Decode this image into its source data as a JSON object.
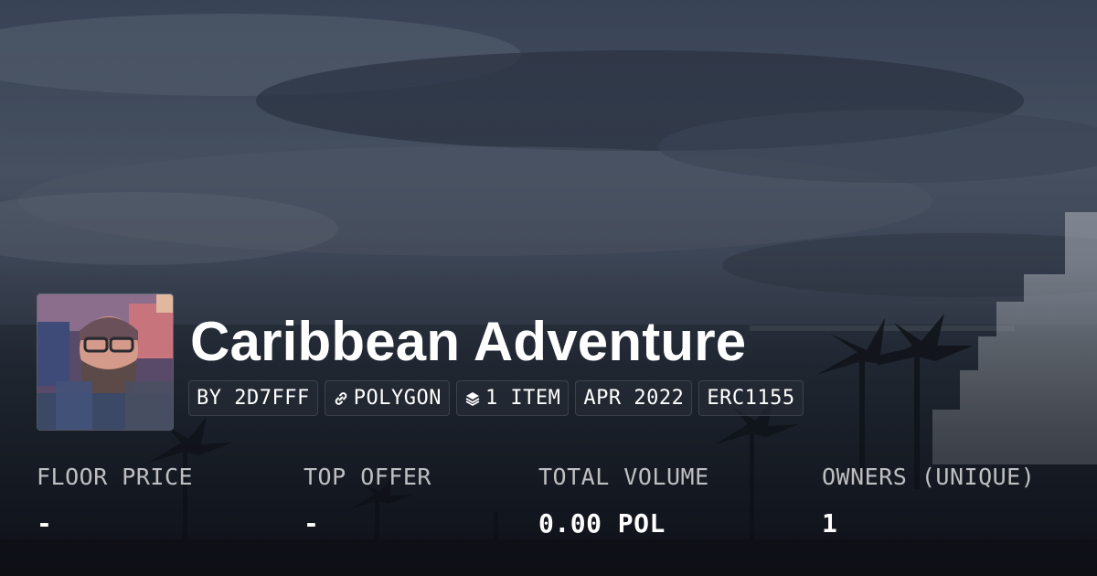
{
  "collection": {
    "title": "Caribbean Adventure",
    "tags": [
      {
        "label": "BY 2D7FFF",
        "icon": ""
      },
      {
        "label": "POLYGON",
        "icon": "chain-link-icon"
      },
      {
        "label": "1 ITEM",
        "icon": "layers-icon"
      },
      {
        "label": "APR 2022",
        "icon": ""
      },
      {
        "label": "ERC1155",
        "icon": ""
      }
    ]
  },
  "stats": [
    {
      "label": "FLOOR PRICE",
      "value": "-"
    },
    {
      "label": "TOP OFFER",
      "value": "-"
    },
    {
      "label": "TOTAL VOLUME",
      "value": "0.00 POL"
    },
    {
      "label": "OWNERS (UNIQUE)",
      "value": "1"
    }
  ],
  "colors": {
    "text": "#ffffff",
    "muted_label": "#b8bcc4",
    "tag_background": "#2a2f38"
  }
}
